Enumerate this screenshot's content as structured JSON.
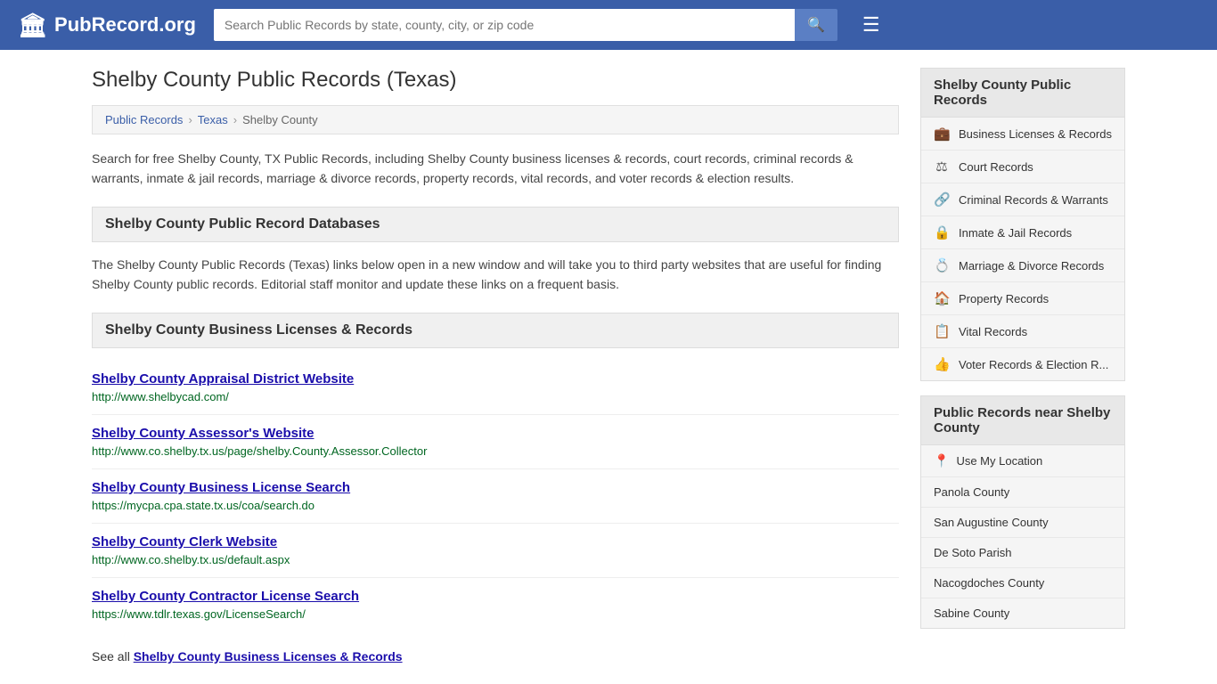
{
  "header": {
    "logo_icon": "🏛",
    "logo_text": "PubRecord.org",
    "search_placeholder": "Search Public Records by state, county, city, or zip code",
    "search_icon": "🔍",
    "menu_icon": "☰"
  },
  "page": {
    "title": "Shelby County Public Records (Texas)"
  },
  "breadcrumb": {
    "items": [
      "Public Records",
      "Texas",
      "Shelby County"
    ]
  },
  "description": "Search for free Shelby County, TX Public Records, including Shelby County business licenses & records, court records, criminal records & warrants, inmate & jail records, marriage & divorce records, property records, vital records, and voter records & election results.",
  "db_section_header": "Shelby County Public Record Databases",
  "db_description": "The Shelby County Public Records (Texas) links below open in a new window and will take you to third party websites that are useful for finding Shelby County public records. Editorial staff monitor and update these links on a frequent basis.",
  "biz_section_header": "Shelby County Business Licenses & Records",
  "records": [
    {
      "title": "Shelby County Appraisal District Website",
      "url": "http://www.shelbycad.com/"
    },
    {
      "title": "Shelby County Assessor's Website",
      "url": "http://www.co.shelby.tx.us/page/shelby.County.Assessor.Collector"
    },
    {
      "title": "Shelby County Business License Search",
      "url": "https://mycpa.cpa.state.tx.us/coa/search.do"
    },
    {
      "title": "Shelby County Clerk Website",
      "url": "http://www.co.shelby.tx.us/default.aspx"
    },
    {
      "title": "Shelby County Contractor License Search",
      "url": "https://www.tdlr.texas.gov/LicenseSearch/"
    }
  ],
  "see_all_text": "See all",
  "see_all_link_text": "Shelby County Business Licenses & Records",
  "sidebar": {
    "box1_header": "Shelby County Public Records",
    "record_types": [
      {
        "icon": "💼",
        "label": "Business Licenses & Records"
      },
      {
        "icon": "⚖",
        "label": "Court Records"
      },
      {
        "icon": "🔗",
        "label": "Criminal Records & Warrants"
      },
      {
        "icon": "🔒",
        "label": "Inmate & Jail Records"
      },
      {
        "icon": "💍",
        "label": "Marriage & Divorce Records"
      },
      {
        "icon": "🏠",
        "label": "Property Records"
      },
      {
        "icon": "📋",
        "label": "Vital Records"
      },
      {
        "icon": "👍",
        "label": "Voter Records & Election R..."
      }
    ],
    "box2_header": "Public Records near Shelby County",
    "nearby": [
      {
        "label": "Use My Location",
        "is_location": true,
        "icon": "📍"
      },
      {
        "label": "Panola County"
      },
      {
        "label": "San Augustine County"
      },
      {
        "label": "De Soto Parish"
      },
      {
        "label": "Nacogdoches County"
      },
      {
        "label": "Sabine County"
      }
    ]
  }
}
